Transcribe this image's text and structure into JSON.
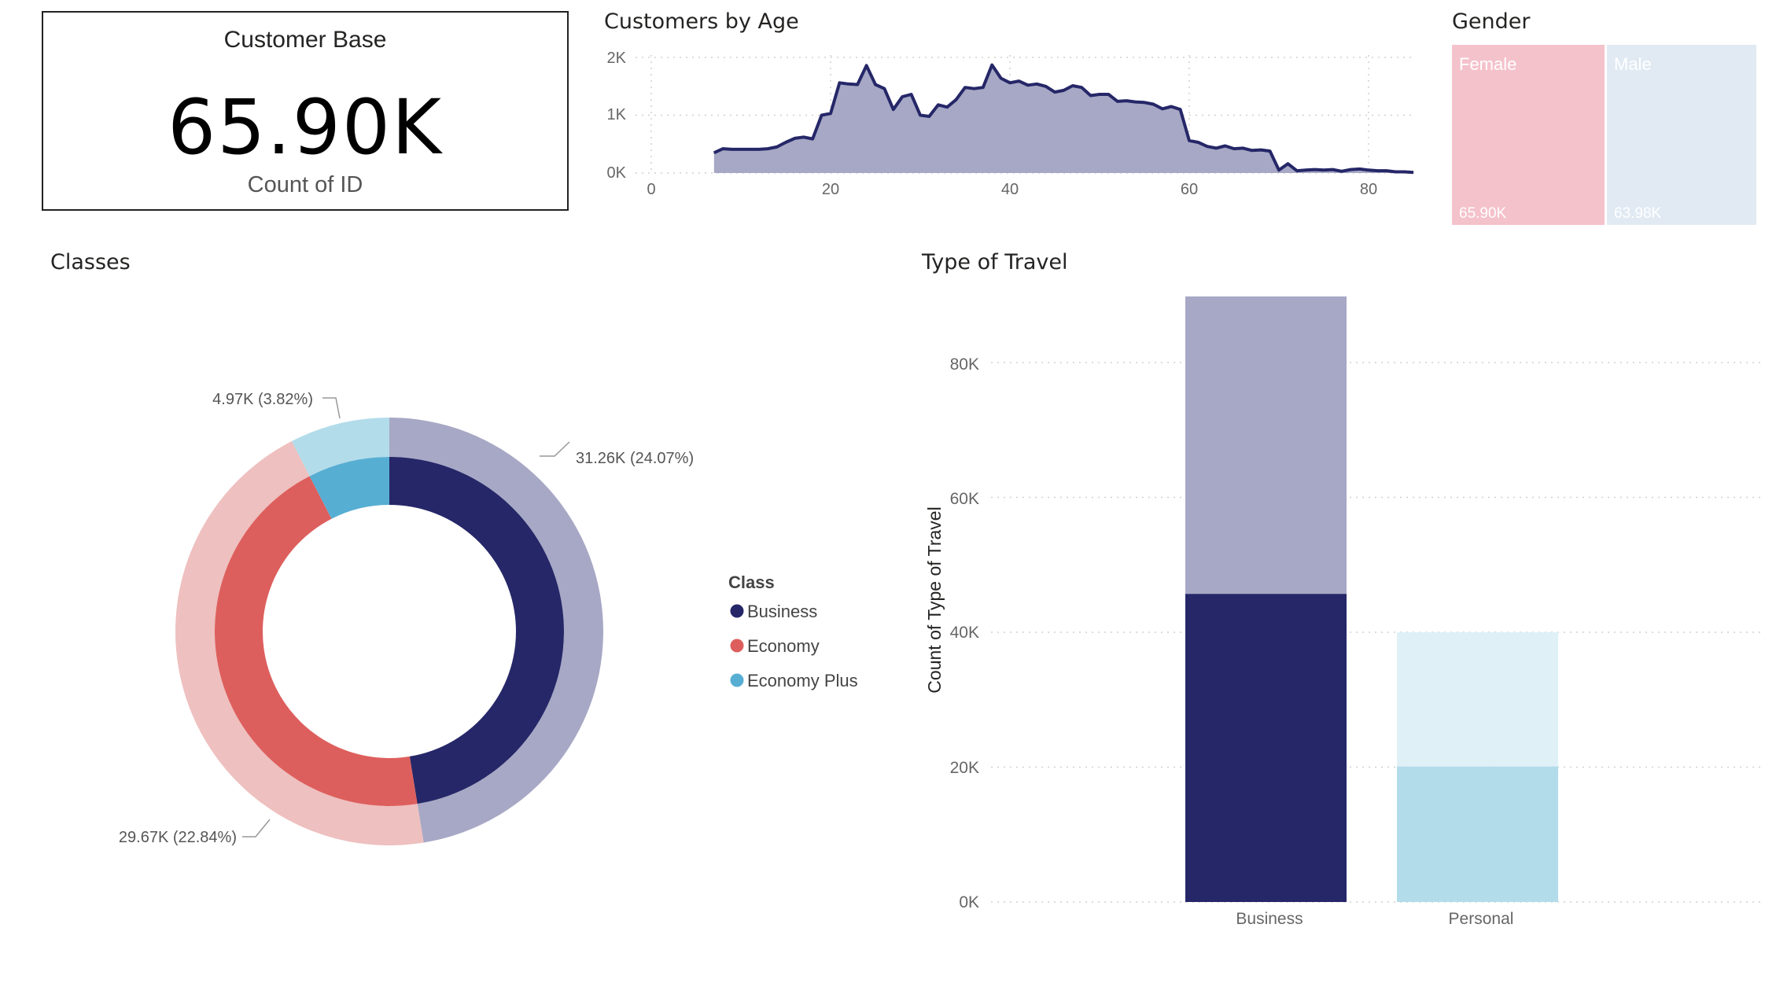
{
  "card": {
    "title": "Customer Base",
    "value": "65.90K",
    "subtitle": "Count of ID"
  },
  "age_chart": {
    "title": "Customers by Age",
    "y_ticks": [
      "2K",
      "1K",
      "0K"
    ],
    "x_ticks": [
      "0",
      "20",
      "40",
      "60",
      "80"
    ]
  },
  "gender": {
    "title": "Gender",
    "items": [
      {
        "label": "Female",
        "value": "65.90K",
        "color": "#f4c2cb"
      },
      {
        "label": "Male",
        "value": "63.98K",
        "color": "#e1eaf3"
      }
    ]
  },
  "classes": {
    "title": "Classes",
    "legend_title": "Class",
    "legend": [
      {
        "label": "Business",
        "color": "#252768"
      },
      {
        "label": "Economy",
        "color": "#dd5f5d"
      },
      {
        "label": "Economy Plus",
        "color": "#57aed3"
      }
    ],
    "labels": {
      "business": "31.26K (24.07%)",
      "economy": "29.67K (22.84%)",
      "economy_plus": "4.97K (3.82%)"
    }
  },
  "travel": {
    "title": "Type of Travel",
    "y_axis_title": "Count of Type of Travel",
    "y_ticks": [
      "80K",
      "60K",
      "40K",
      "20K",
      "0K"
    ],
    "categories": [
      "Business",
      "Personal"
    ]
  },
  "chart_data": [
    {
      "type": "area",
      "title": "Customers by Age",
      "xlim": [
        0,
        85
      ],
      "ylim": [
        0,
        2000
      ],
      "x": [
        7,
        8,
        9,
        10,
        11,
        12,
        13,
        14,
        15,
        16,
        17,
        18,
        19,
        20,
        21,
        22,
        23,
        24,
        25,
        26,
        27,
        28,
        29,
        30,
        31,
        32,
        33,
        34,
        35,
        36,
        37,
        38,
        39,
        40,
        41,
        42,
        43,
        44,
        45,
        46,
        47,
        48,
        49,
        50,
        51,
        52,
        53,
        54,
        55,
        56,
        57,
        58,
        59,
        60,
        61,
        62,
        63,
        64,
        65,
        66,
        67,
        68,
        69,
        70,
        71,
        72,
        73,
        74,
        75,
        76,
        77,
        78,
        79,
        80,
        81,
        82,
        83,
        84,
        85
      ],
      "y": [
        350,
        420,
        410,
        410,
        410,
        410,
        420,
        450,
        530,
        600,
        620,
        590,
        1000,
        1030,
        1560,
        1540,
        1530,
        1860,
        1530,
        1460,
        1100,
        1320,
        1360,
        1000,
        980,
        1180,
        1140,
        1270,
        1480,
        1460,
        1480,
        1870,
        1640,
        1560,
        1590,
        1520,
        1540,
        1500,
        1400,
        1430,
        1510,
        1480,
        1340,
        1360,
        1360,
        1240,
        1250,
        1230,
        1220,
        1190,
        1110,
        1150,
        1100,
        560,
        530,
        460,
        430,
        470,
        420,
        430,
        390,
        400,
        380,
        50,
        160,
        40,
        50,
        60,
        50,
        60,
        30,
        60,
        70,
        50,
        40,
        40,
        20,
        20,
        10
      ],
      "series": [
        {
          "name": "",
          "color": "#a7a8c5",
          "line_color": "#252768"
        }
      ]
    },
    {
      "type": "pie",
      "title": "Classes",
      "legend_title": "Class",
      "categories": [
        "Business",
        "Economy",
        "Economy Plus"
      ],
      "rings": [
        {
          "name": "outer",
          "values": [
            31260,
            29670,
            4970
          ],
          "labels": [
            "31.26K (24.07%)",
            "29.67K (22.84%)",
            "4.97K (3.82%)"
          ],
          "colors": [
            "#a7a8c5",
            "#eec0bf",
            "#b3dcea"
          ]
        },
        {
          "name": "inner",
          "values": [
            31260,
            29670,
            4970
          ],
          "colors": [
            "#252768",
            "#dd5f5d",
            "#57aed3"
          ]
        }
      ]
    },
    {
      "type": "bar",
      "title": "Type of Travel",
      "categories": [
        "Business",
        "Personal"
      ],
      "stacked": true,
      "ylabel": "Count of Type of Travel",
      "ylim": [
        0,
        90000
      ],
      "y_ticks": [
        0,
        20000,
        40000,
        60000,
        80000
      ],
      "series": [
        {
          "name": "",
          "values": [
            45700,
            20100
          ],
          "colors": [
            "#252768",
            "#b3dcea"
          ]
        },
        {
          "name": "",
          "values": [
            44100,
            19900
          ],
          "colors": [
            "#a7a8c5",
            "#dff0f7"
          ]
        }
      ]
    },
    {
      "type": "treemap",
      "title": "Gender",
      "categories": [
        "Female",
        "Male"
      ],
      "values": [
        65900,
        63980
      ],
      "colors": [
        "#f4c2cb",
        "#e1eaf3"
      ]
    }
  ]
}
